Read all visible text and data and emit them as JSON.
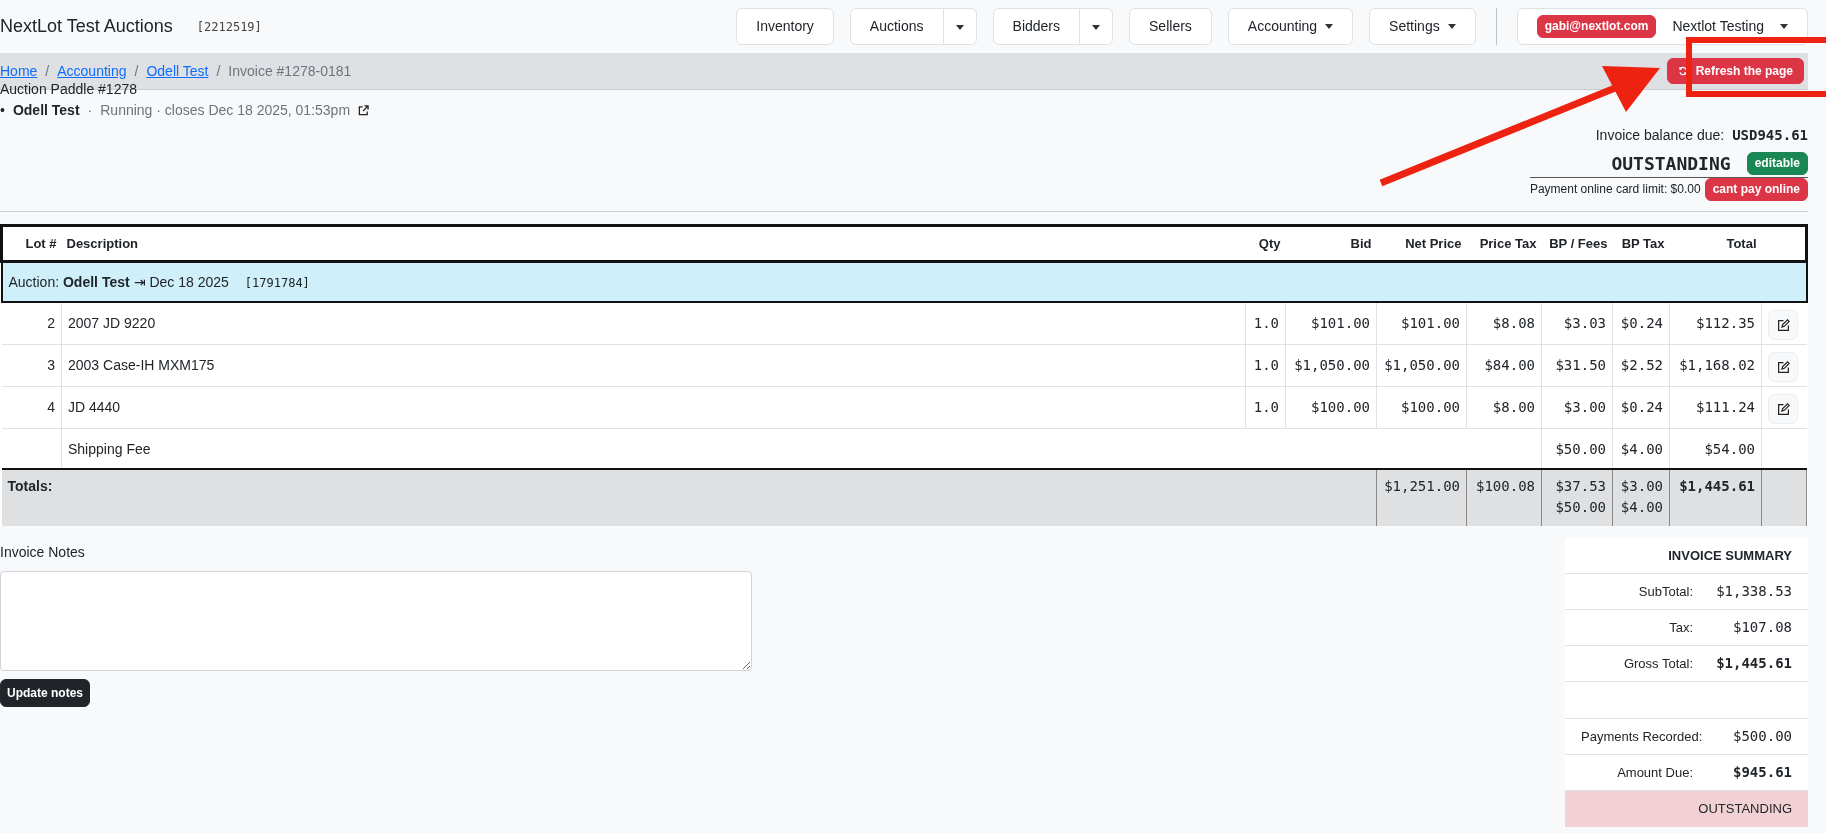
{
  "navbar": {
    "brand": "NextLot Test Auctions",
    "code": "[2212519]",
    "buttons": [
      {
        "label": "Inventory",
        "kind": "plain"
      },
      {
        "label": "Auctions",
        "kind": "split"
      },
      {
        "label": "Bidders",
        "kind": "split"
      },
      {
        "label": "Sellers",
        "kind": "plain"
      },
      {
        "label": "Accounting",
        "kind": "dropdown"
      },
      {
        "label": "Settings",
        "kind": "dropdown"
      }
    ],
    "user": {
      "email": "gabi@nextlot.com",
      "name": "Nextlot Testing"
    }
  },
  "breadcrumb": {
    "items": [
      {
        "label": "Home",
        "link": true
      },
      {
        "label": "Accounting",
        "link": true
      },
      {
        "label": "Odell Test",
        "link": true
      },
      {
        "label": "Invoice #1278-0181",
        "link": false
      }
    ],
    "separator": "/",
    "refresh_button": "Refresh the page"
  },
  "paddle": "Auction Paddle #1278",
  "auction": {
    "bullet": "•",
    "name": "Odell Test",
    "separator": "·",
    "status": "Running · closes Dec 18 2025, 01:53pm"
  },
  "balance": {
    "label": "Invoice balance due:",
    "value": "USD945.61",
    "status": "OUTSTANDING",
    "status_badge": "editable",
    "card_limit": "Payment online card limit: $0.00",
    "card_badge": "cant pay online"
  },
  "table": {
    "columns": [
      "Lot #",
      "Description",
      "Qty",
      "Bid",
      "Net Price",
      "Price Tax",
      "BP / Fees",
      "BP Tax",
      "Total"
    ],
    "group": {
      "prefix": "Auction:",
      "name": "Odell Test",
      "arrow": "⇥",
      "date": "Dec 18 2025",
      "code": "[1791784]"
    },
    "rows": [
      {
        "kind": "lot",
        "lot": "2",
        "description": "2007 JD 9220",
        "qty": "1.0",
        "bid": "$101.00",
        "net": "$101.00",
        "price_tax": "$8.08",
        "bp": "$3.03",
        "bp_tax": "$0.24",
        "total": "$112.35",
        "editable": true
      },
      {
        "kind": "lot",
        "lot": "3",
        "description": "2003 Case-IH MXM175",
        "qty": "1.0",
        "bid": "$1,050.00",
        "net": "$1,050.00",
        "price_tax": "$84.00",
        "bp": "$31.50",
        "bp_tax": "$2.52",
        "total": "$1,168.02",
        "editable": true
      },
      {
        "kind": "lot",
        "lot": "4",
        "description": "JD 4440",
        "qty": "1.0",
        "bid": "$100.00",
        "net": "$100.00",
        "price_tax": "$8.00",
        "bp": "$3.00",
        "bp_tax": "$0.24",
        "total": "$111.24",
        "editable": true
      },
      {
        "kind": "fee",
        "description": "Shipping Fee",
        "bp": "$50.00",
        "bp_tax": "$4.00",
        "total": "$54.00",
        "editable": false
      }
    ],
    "totals": {
      "label": "Totals:",
      "net": "$1,251.00",
      "price_tax": "$100.08",
      "bp": [
        "$37.53",
        "$50.00"
      ],
      "bp_tax": [
        "$3.00",
        "$4.00"
      ],
      "total": "$1,445.61"
    }
  },
  "notes": {
    "label": "Invoice Notes",
    "button": "Update notes"
  },
  "summary": {
    "title": "INVOICE SUMMARY",
    "rows": [
      {
        "kind": "line",
        "label": "SubTotal:",
        "value": "$1,338.53",
        "bold": false
      },
      {
        "kind": "line",
        "label": "Tax:",
        "value": "$107.08",
        "bold": false
      },
      {
        "kind": "line",
        "label": "Gross Total:",
        "value": "$1,445.61",
        "bold": true
      },
      {
        "kind": "spacer"
      },
      {
        "kind": "line",
        "label": "Payments Recorded:",
        "value": "$500.00",
        "bold": false
      },
      {
        "kind": "line",
        "label": "Amount Due:",
        "value": "$945.61",
        "bold": true
      }
    ],
    "status": "OUTSTANDING"
  },
  "annotation": {
    "kind": "arrow-and-box",
    "color": "#ee2211"
  }
}
